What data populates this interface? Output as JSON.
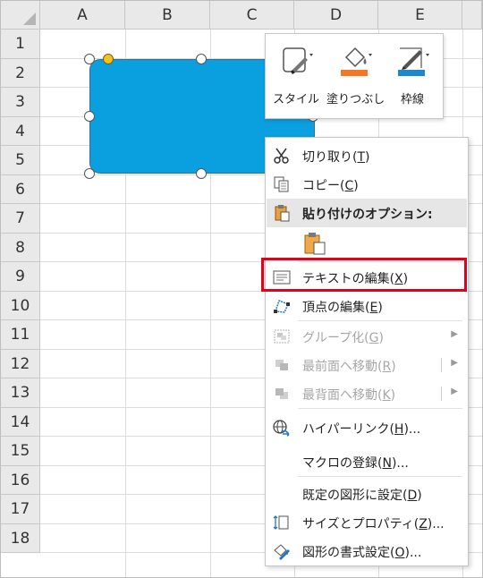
{
  "columns": [
    "A",
    "B",
    "C",
    "D",
    "E"
  ],
  "rows": [
    "1",
    "2",
    "3",
    "4",
    "5",
    "6",
    "7",
    "8",
    "9",
    "10",
    "11",
    "12",
    "13",
    "14",
    "15",
    "16",
    "17",
    "18"
  ],
  "mini_toolbar": {
    "style_label": "スタイル",
    "fill_label": "塗りつぶし",
    "outline_label": "枠線",
    "fill_color": "#f07828",
    "outline_color": "#1e88c8"
  },
  "shape": {
    "fill_color": "#0a9fdf"
  },
  "context_menu": {
    "cut": {
      "label": "切り取り(",
      "key": "T",
      "end": ")"
    },
    "copy": {
      "label": "コピー(",
      "key": "C",
      "end": ")"
    },
    "paste_options": "貼り付けのオプション:",
    "edit_text": {
      "label": "テキストの編集(",
      "key": "X",
      "end": ")"
    },
    "edit_points": {
      "label": "頂点の編集(",
      "key": "E",
      "end": ")"
    },
    "group": {
      "label": "グループ化(",
      "key": "G",
      "end": ")"
    },
    "bring_front": {
      "label": "最前面へ移動(",
      "key": "R",
      "end": ")"
    },
    "send_back": {
      "label": "最背面へ移動(",
      "key": "K",
      "end": ")"
    },
    "hyperlink": {
      "label": "ハイパーリンク(",
      "key": "H",
      "end": ")..."
    },
    "assign_macro": {
      "label": "マクロの登録(",
      "key": "N",
      "end": ")..."
    },
    "set_default": {
      "label": "既定の図形に設定(",
      "key": "D",
      "end": ")"
    },
    "size_properties": {
      "label": "サイズとプロパティ(",
      "key": "Z",
      "end": ")..."
    },
    "format_shape": {
      "label": "図形の書式設定(",
      "key": "O",
      "end": ")..."
    }
  }
}
